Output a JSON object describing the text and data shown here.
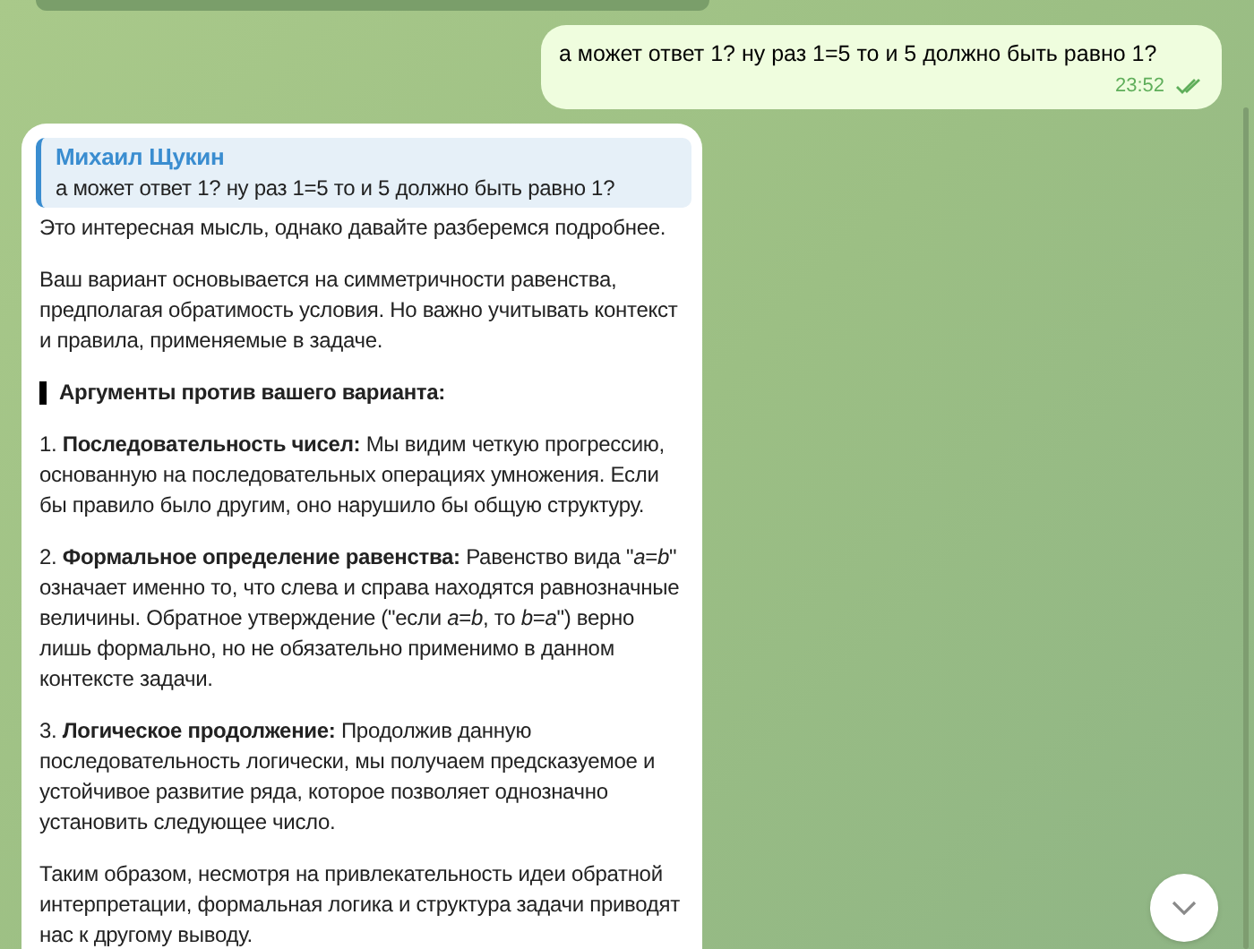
{
  "outgoing": {
    "text": "а может ответ 1? ну раз 1=5 то и 5 должно быть равно 1?",
    "time": "23:52",
    "read": true
  },
  "incoming": {
    "reply": {
      "author": "Михаил Щукин",
      "text": "а может ответ 1? ну раз 1=5 то и 5 должно быть равно 1?"
    },
    "paragraphs": [
      {
        "kind": "text",
        "text": "Это интересная мысль, однако давайте разберемся подробнее."
      },
      {
        "kind": "text",
        "text": "Ваш вариант основывается на симметричности равенства, предполагая обратимость условия. Но важно учитывать контекст и правила, применяемые в задаче."
      },
      {
        "kind": "heading",
        "text": "Аргументы против вашего варианта:"
      },
      {
        "kind": "text",
        "text": "1. **Последовательность чисел:** Мы видим четкую прогрессию, основанную на последовательных операциях умножения. Если бы правило было другим, оно нарушило бы общую структуру."
      },
      {
        "kind": "text",
        "text": "2. **Формальное определение равенства:** Равенство вида \"*a*=*b*\" означает именно то, что слева и справа находятся равнозначные величины. Обратное утверждение (\"если *a*=*b*, то *b*=*a*\") верно лишь формально, но не обязательно применимо в данном контексте задачи."
      },
      {
        "kind": "text",
        "text": "3. **Логическое продолжение:** Продолжив данную последовательность логически, мы получаем предсказуемое и устойчивое развитие ряда, которое позволяет однозначно установить следующее число."
      },
      {
        "kind": "text",
        "text": "Таким образом, несмотря на привлекательность идеи обратной интерпретации, формальная логика и структура задачи приводят нас к другому выводу."
      }
    ]
  }
}
